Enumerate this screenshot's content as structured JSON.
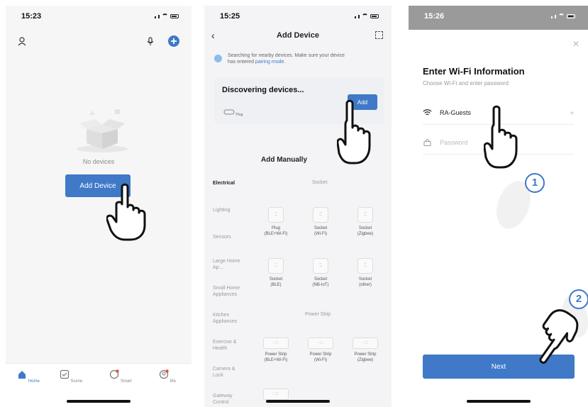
{
  "screen1": {
    "time": "15:23",
    "empty_text": "No devices",
    "add_button": "Add Device",
    "tabs": [
      {
        "label": "Home",
        "icon": "home-icon"
      },
      {
        "label": "Scene",
        "icon": "scene-icon"
      },
      {
        "label": "Smart",
        "icon": "smart-icon"
      },
      {
        "label": "Me",
        "icon": "me-icon"
      }
    ]
  },
  "screen2": {
    "time": "15:25",
    "title": "Add Device",
    "search_note_1": "Searching for nearby devices. Make sure your device",
    "search_note_2": "has entered ",
    "search_note_link": "pairing mode",
    "search_note_end": ".",
    "discover_title": "Discovering devices...",
    "discover_add": "Add",
    "discover_device_label": "Plug",
    "manual_title": "Add Manually",
    "categories": [
      "Electrical",
      "Lighting",
      "Sensors",
      "Large Home Ap...",
      "Small Home Appliances",
      "Kitchen Appliances",
      "Exercise & Health",
      "Camera & Lock",
      "Gateway Control"
    ],
    "section_socket": "Socket",
    "sockets": [
      {
        "line1": "Plug",
        "line2": "(BLE+Wi-Fi)"
      },
      {
        "line1": "Socket",
        "line2": "(Wi-Fi)"
      },
      {
        "line1": "Socket",
        "line2": "(Zigbee)"
      },
      {
        "line1": "Socket",
        "line2": "(BLE)"
      },
      {
        "line1": "Socket",
        "line2": "(NB-IoT)"
      },
      {
        "line1": "Socket",
        "line2": "(other)"
      }
    ],
    "section_strip": "Power Strip",
    "strips": [
      {
        "line1": "Power Strip",
        "line2": "(BLE+Wi-Fi)"
      },
      {
        "line1": "Power Strip",
        "line2": "(Wi-Fi)"
      },
      {
        "line1": "Power Strip",
        "line2": "(Zigbee)"
      }
    ]
  },
  "screen3": {
    "time": "15:26",
    "title": "Enter Wi-Fi Information",
    "subtitle": "Choose Wi-Fi and enter password",
    "wifi_value": "RA-Guests",
    "switch_label": "⇆",
    "password_placeholder": "Password",
    "next_button": "Next"
  },
  "badges": [
    "1",
    "2"
  ],
  "colors": {
    "accent": "#3f79c8",
    "badge": "#3f79c8"
  }
}
